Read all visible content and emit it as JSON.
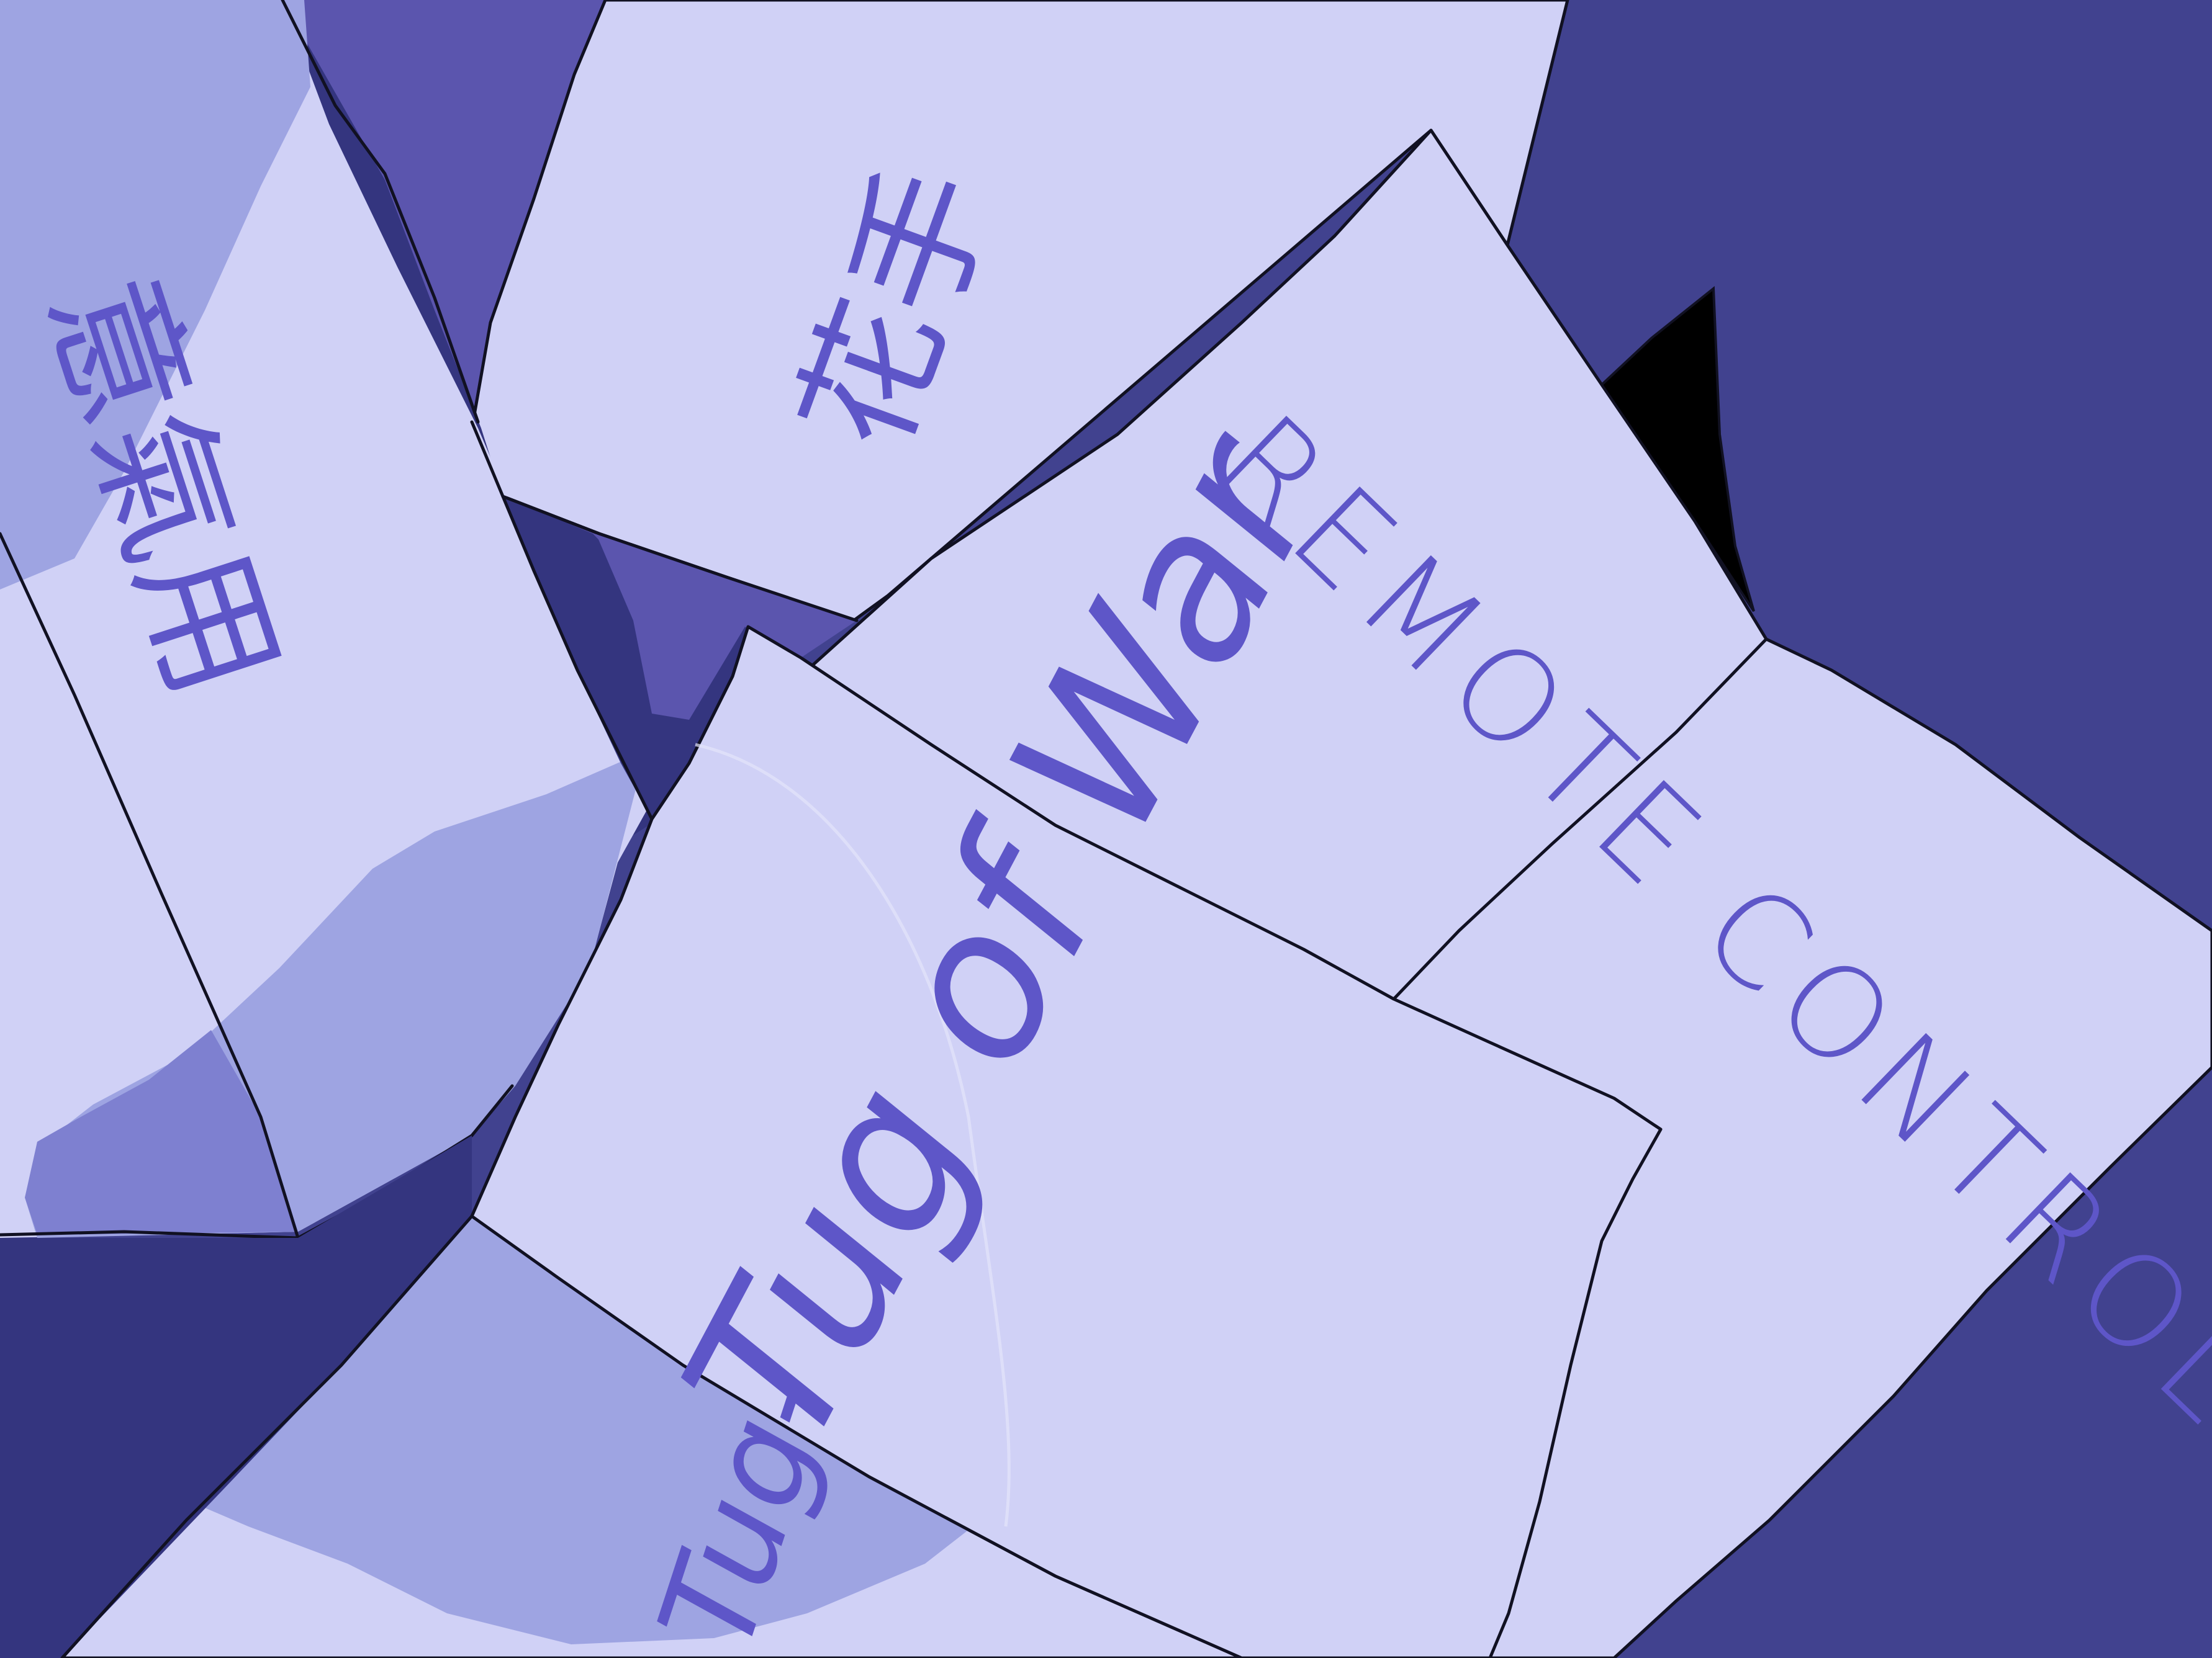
{
  "scene": {
    "background_color": "#41428f",
    "card_color": "#d0d1f6",
    "shadow_colors": [
      "#9ea4e2",
      "#7e80d0",
      "#5b55ae",
      "#34357f"
    ],
    "ink_color": "#5a52c8",
    "outline_color": "#111122"
  },
  "labels": {
    "remote_control": "REMOTE CONTROL",
    "tug_of_war": "Tug of War",
    "top_chinese": "花手",
    "left_chinese": "意氣用",
    "bottom_fragment": "Tug-"
  }
}
